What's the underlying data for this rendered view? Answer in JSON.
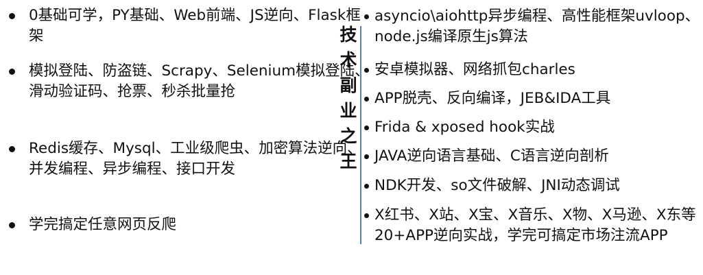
{
  "left_items": [
    "0基础可学，PY基础、Web前端、JS逆向、Flask框架",
    "模拟登陆、防盗链、Scrapy、Selenium模拟登陆、滑动验证码、抢票、秒杀批量抢",
    "Redis缓存、Mysql、工业级爬虫、加密算法逆向、并发编程、异步编程、接口开发",
    "学完搞定任意网页反爬"
  ],
  "title_chars": [
    "技",
    "术",
    "副",
    "业",
    "之",
    "王"
  ],
  "right_items": [
    "asyncio\\aiohttp异步编程、高性能框架uvloop、node.js编译原生js算法",
    "安卓模拟器、网络抓包charles",
    "APP脱壳、反向编译，JEB&IDA工具",
    "Frida & xposed hook实战",
    "JAVA逆向语言基础、C语言逆向剖析",
    "NDK开发、so文件破解、JNI动态调试",
    "X红书、X站、X宝、X音乐、X物、X马逊、X东等20+APP逆向实战，学完可搞定市场注流APP"
  ]
}
